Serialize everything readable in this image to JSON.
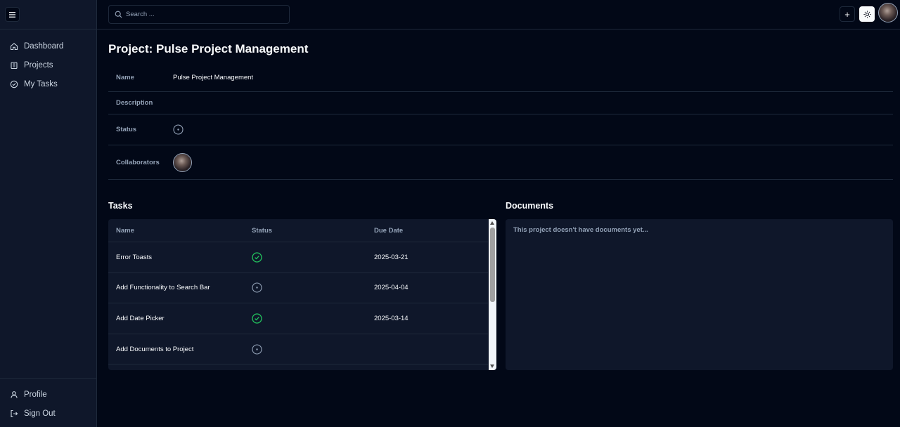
{
  "sidebar": {
    "nav": [
      {
        "label": "Dashboard",
        "icon": "home-icon"
      },
      {
        "label": "Projects",
        "icon": "building-icon"
      },
      {
        "label": "My Tasks",
        "icon": "check-circle-icon"
      }
    ],
    "bottom": [
      {
        "label": "Profile",
        "icon": "user-icon"
      },
      {
        "label": "Sign Out",
        "icon": "sign-out-icon"
      }
    ]
  },
  "header": {
    "search_placeholder": "Search ...",
    "add_label": "+"
  },
  "project": {
    "title": "Project: Pulse Project Management",
    "fields": {
      "name_label": "Name",
      "name_value": "Pulse Project Management",
      "description_label": "Description",
      "status_label": "Status",
      "collaborators_label": "Collaborators"
    }
  },
  "tasks": {
    "title": "Tasks",
    "columns": [
      "Name",
      "Status",
      "Due Date"
    ],
    "rows": [
      {
        "name": "Error Toasts",
        "status": "done",
        "due": "2025-03-21"
      },
      {
        "name": "Add Functionality to Search Bar",
        "status": "pending",
        "due": "2025-04-04"
      },
      {
        "name": "Add Date Picker",
        "status": "done",
        "due": "2025-03-14"
      },
      {
        "name": "Add Documents to Project",
        "status": "pending",
        "due": ""
      }
    ]
  },
  "documents": {
    "title": "Documents",
    "empty_text": "This project doesn't have documents yet..."
  },
  "colors": {
    "background": "#020817",
    "panel": "#0f172a",
    "border": "#1e293b",
    "done": "#22c55e",
    "muted": "#94a3b8"
  }
}
